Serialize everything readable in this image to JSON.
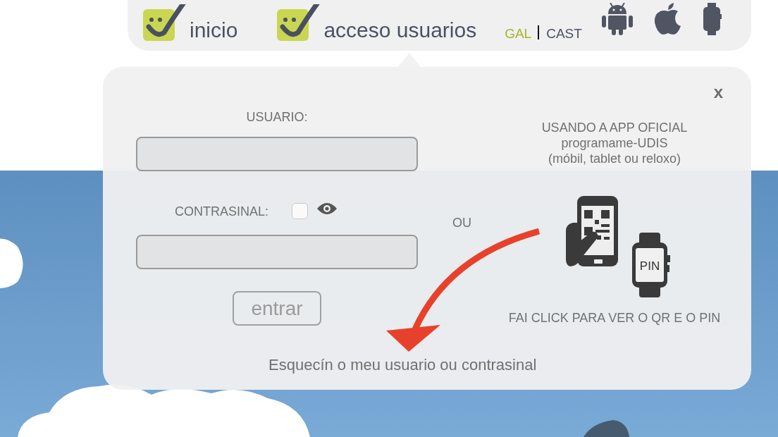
{
  "nav": {
    "items": [
      {
        "label": "inicio"
      },
      {
        "label": "acceso usuarios"
      }
    ],
    "languages": [
      {
        "label": "GAL",
        "selected": true
      },
      {
        "label": "CAST",
        "selected": false
      }
    ]
  },
  "login": {
    "close": "x",
    "user_label": "USUARIO:",
    "password_label": "CONTRASINAL:",
    "show_password": {
      "checked": false
    },
    "submit": "entrar",
    "or": "OU",
    "app_lines": [
      "USANDO A APP OFICIAL",
      "programame-UDIS",
      "(móbil, tablet ou reloxo)"
    ],
    "watch_text": "PIN",
    "qr_hint": "FAI CLICK PARA VER O QR E O PIN",
    "forgot_link": "Esquecín o meu usuario ou contrasinal"
  }
}
